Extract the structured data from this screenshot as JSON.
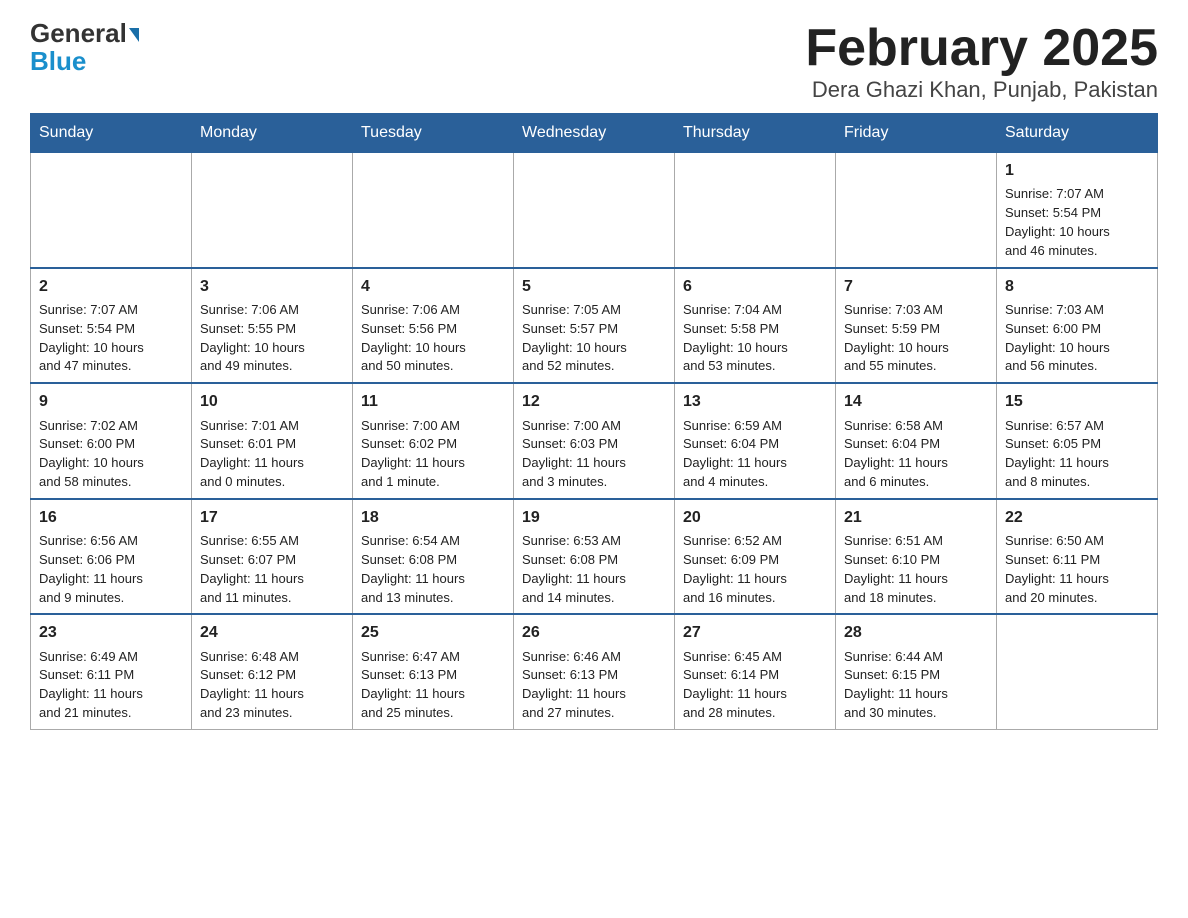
{
  "logo": {
    "general": "General",
    "blue": "Blue"
  },
  "title": "February 2025",
  "subtitle": "Dera Ghazi Khan, Punjab, Pakistan",
  "days": [
    "Sunday",
    "Monday",
    "Tuesday",
    "Wednesday",
    "Thursday",
    "Friday",
    "Saturday"
  ],
  "weeks": [
    [
      {
        "day": "",
        "info": ""
      },
      {
        "day": "",
        "info": ""
      },
      {
        "day": "",
        "info": ""
      },
      {
        "day": "",
        "info": ""
      },
      {
        "day": "",
        "info": ""
      },
      {
        "day": "",
        "info": ""
      },
      {
        "day": "1",
        "info": "Sunrise: 7:07 AM\nSunset: 5:54 PM\nDaylight: 10 hours\nand 46 minutes."
      }
    ],
    [
      {
        "day": "2",
        "info": "Sunrise: 7:07 AM\nSunset: 5:54 PM\nDaylight: 10 hours\nand 47 minutes."
      },
      {
        "day": "3",
        "info": "Sunrise: 7:06 AM\nSunset: 5:55 PM\nDaylight: 10 hours\nand 49 minutes."
      },
      {
        "day": "4",
        "info": "Sunrise: 7:06 AM\nSunset: 5:56 PM\nDaylight: 10 hours\nand 50 minutes."
      },
      {
        "day": "5",
        "info": "Sunrise: 7:05 AM\nSunset: 5:57 PM\nDaylight: 10 hours\nand 52 minutes."
      },
      {
        "day": "6",
        "info": "Sunrise: 7:04 AM\nSunset: 5:58 PM\nDaylight: 10 hours\nand 53 minutes."
      },
      {
        "day": "7",
        "info": "Sunrise: 7:03 AM\nSunset: 5:59 PM\nDaylight: 10 hours\nand 55 minutes."
      },
      {
        "day": "8",
        "info": "Sunrise: 7:03 AM\nSunset: 6:00 PM\nDaylight: 10 hours\nand 56 minutes."
      }
    ],
    [
      {
        "day": "9",
        "info": "Sunrise: 7:02 AM\nSunset: 6:00 PM\nDaylight: 10 hours\nand 58 minutes."
      },
      {
        "day": "10",
        "info": "Sunrise: 7:01 AM\nSunset: 6:01 PM\nDaylight: 11 hours\nand 0 minutes."
      },
      {
        "day": "11",
        "info": "Sunrise: 7:00 AM\nSunset: 6:02 PM\nDaylight: 11 hours\nand 1 minute."
      },
      {
        "day": "12",
        "info": "Sunrise: 7:00 AM\nSunset: 6:03 PM\nDaylight: 11 hours\nand 3 minutes."
      },
      {
        "day": "13",
        "info": "Sunrise: 6:59 AM\nSunset: 6:04 PM\nDaylight: 11 hours\nand 4 minutes."
      },
      {
        "day": "14",
        "info": "Sunrise: 6:58 AM\nSunset: 6:04 PM\nDaylight: 11 hours\nand 6 minutes."
      },
      {
        "day": "15",
        "info": "Sunrise: 6:57 AM\nSunset: 6:05 PM\nDaylight: 11 hours\nand 8 minutes."
      }
    ],
    [
      {
        "day": "16",
        "info": "Sunrise: 6:56 AM\nSunset: 6:06 PM\nDaylight: 11 hours\nand 9 minutes."
      },
      {
        "day": "17",
        "info": "Sunrise: 6:55 AM\nSunset: 6:07 PM\nDaylight: 11 hours\nand 11 minutes."
      },
      {
        "day": "18",
        "info": "Sunrise: 6:54 AM\nSunset: 6:08 PM\nDaylight: 11 hours\nand 13 minutes."
      },
      {
        "day": "19",
        "info": "Sunrise: 6:53 AM\nSunset: 6:08 PM\nDaylight: 11 hours\nand 14 minutes."
      },
      {
        "day": "20",
        "info": "Sunrise: 6:52 AM\nSunset: 6:09 PM\nDaylight: 11 hours\nand 16 minutes."
      },
      {
        "day": "21",
        "info": "Sunrise: 6:51 AM\nSunset: 6:10 PM\nDaylight: 11 hours\nand 18 minutes."
      },
      {
        "day": "22",
        "info": "Sunrise: 6:50 AM\nSunset: 6:11 PM\nDaylight: 11 hours\nand 20 minutes."
      }
    ],
    [
      {
        "day": "23",
        "info": "Sunrise: 6:49 AM\nSunset: 6:11 PM\nDaylight: 11 hours\nand 21 minutes."
      },
      {
        "day": "24",
        "info": "Sunrise: 6:48 AM\nSunset: 6:12 PM\nDaylight: 11 hours\nand 23 minutes."
      },
      {
        "day": "25",
        "info": "Sunrise: 6:47 AM\nSunset: 6:13 PM\nDaylight: 11 hours\nand 25 minutes."
      },
      {
        "day": "26",
        "info": "Sunrise: 6:46 AM\nSunset: 6:13 PM\nDaylight: 11 hours\nand 27 minutes."
      },
      {
        "day": "27",
        "info": "Sunrise: 6:45 AM\nSunset: 6:14 PM\nDaylight: 11 hours\nand 28 minutes."
      },
      {
        "day": "28",
        "info": "Sunrise: 6:44 AM\nSunset: 6:15 PM\nDaylight: 11 hours\nand 30 minutes."
      },
      {
        "day": "",
        "info": ""
      }
    ]
  ]
}
